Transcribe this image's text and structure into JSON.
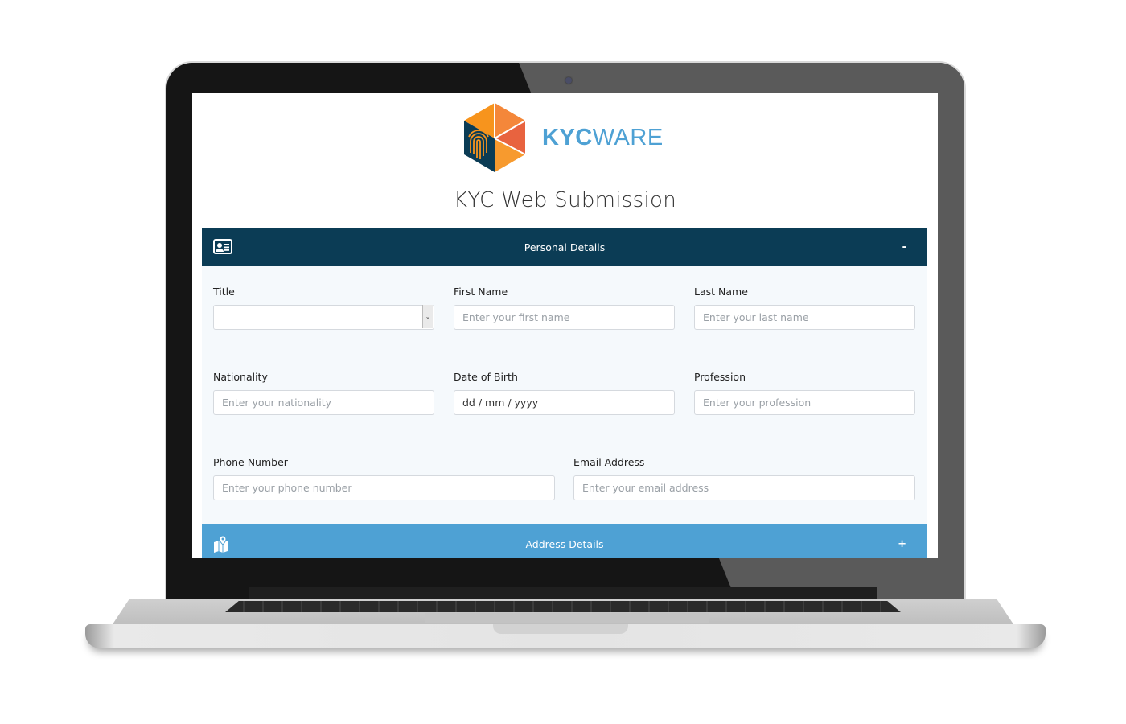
{
  "brand": {
    "name_bold": "KYC",
    "name_light": "WARE",
    "logo_icon": "fingerprint-hexagon-icon",
    "colors": {
      "primary_dark": "#0b3c55",
      "accent_blue": "#4ea1d4",
      "logo_orange": "#f7941d"
    }
  },
  "page": {
    "title": "KYC Web Submission"
  },
  "sections": [
    {
      "title": "Personal Details",
      "icon": "id-card-icon",
      "toggle": "-",
      "state": "expanded"
    },
    {
      "title": "Address Details",
      "icon": "map-location-icon",
      "toggle": "+",
      "state": "collapsed"
    }
  ],
  "personal_form": {
    "title": {
      "label": "Title",
      "value": ""
    },
    "first_name": {
      "label": "First Name",
      "placeholder": "Enter your first name"
    },
    "last_name": {
      "label": "Last Name",
      "placeholder": "Enter your last name"
    },
    "nationality": {
      "label": "Nationality",
      "placeholder": "Enter your nationality"
    },
    "dob": {
      "label": "Date of Birth",
      "value": "dd / mm / yyyy"
    },
    "profession": {
      "label": "Profession",
      "placeholder": "Enter your profession"
    },
    "phone": {
      "label": "Phone Number",
      "placeholder": "Enter your phone number"
    },
    "email": {
      "label": "Email Address",
      "placeholder": "Enter your email address"
    }
  }
}
